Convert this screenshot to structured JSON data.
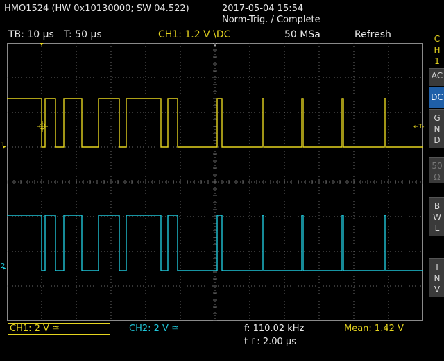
{
  "header": {
    "device": "HMO1524 (HW 0x10130000; SW 04.522)",
    "datetime": "2017-05-04 15:54",
    "trigger_state": "Norm-Trig. / Complete"
  },
  "status": {
    "timebase": "TB: 10 µs",
    "trigger_time": "T: 50 µs",
    "ch1_trigger": "CH1: 1.2 V \\DC",
    "sample_rate": "50 MSa",
    "mode": "Refresh"
  },
  "side_menu": {
    "channel": [
      "C",
      "H",
      "1"
    ],
    "coupling_ac": [
      "A",
      "C"
    ],
    "coupling_dc": [
      "D",
      "C"
    ],
    "gnd": [
      "G",
      "N",
      "D"
    ],
    "impedance": [
      "5",
      "0",
      "Ω"
    ],
    "bwl": [
      "B",
      "W",
      "L"
    ],
    "inv": [
      "I",
      "N",
      "V"
    ]
  },
  "markers": {
    "ch1": "1",
    "ch2": "2",
    "trigger_level": "←T-"
  },
  "bottom": {
    "ch1_scale": "CH1: 2 V ≅",
    "ch2_scale": "CH2: 2 V ≅",
    "frequency": "f: 110.02 kHz",
    "pulse_width": "t ⎍: 2.00 µs",
    "mean": "Mean: 1.42 V"
  },
  "colors": {
    "ch1": "#e5d41f",
    "ch2": "#1fc6d8",
    "grid": "#6a6a6a",
    "active_button": "#1f5fa8"
  }
}
